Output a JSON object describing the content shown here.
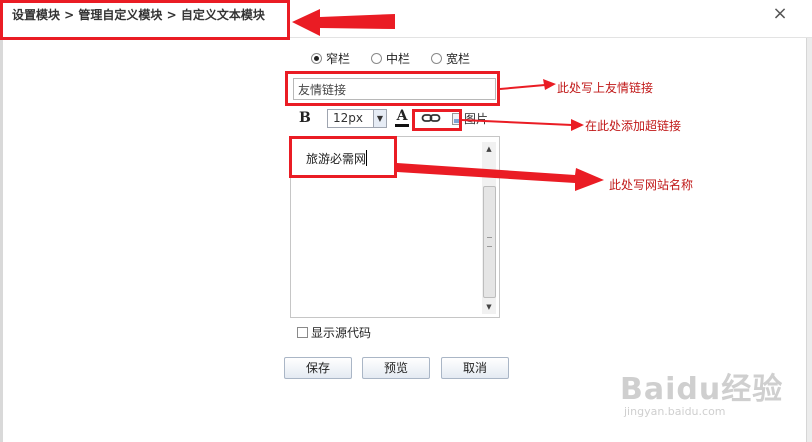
{
  "breadcrumb": "设置模块 > 管理自定义模块 > 自定义文本模块",
  "close_glyph": "×",
  "layout_options": [
    {
      "label": "窄栏",
      "selected": true
    },
    {
      "label": "中栏",
      "selected": false
    },
    {
      "label": "宽栏",
      "selected": false
    }
  ],
  "title_input": {
    "value": "友情链接"
  },
  "toolbar": {
    "bold_label": "B",
    "font_size": "12px",
    "color_label": "A",
    "link_icon": "link-icon",
    "image_label": "图片"
  },
  "editor": {
    "content": "旅游必需网"
  },
  "source_toggle": {
    "label": "显示源代码",
    "checked": false
  },
  "buttons": {
    "save": "保存",
    "preview": "预览",
    "cancel": "取消"
  },
  "annotations": {
    "title_note": "此处写上友情链接",
    "link_note": "在此处添加超链接",
    "site_note": "此处写网站名称",
    "color": "#ea1c24"
  },
  "watermark": {
    "logo": "Baidu经验",
    "url": "jingyan.baidu.com"
  }
}
